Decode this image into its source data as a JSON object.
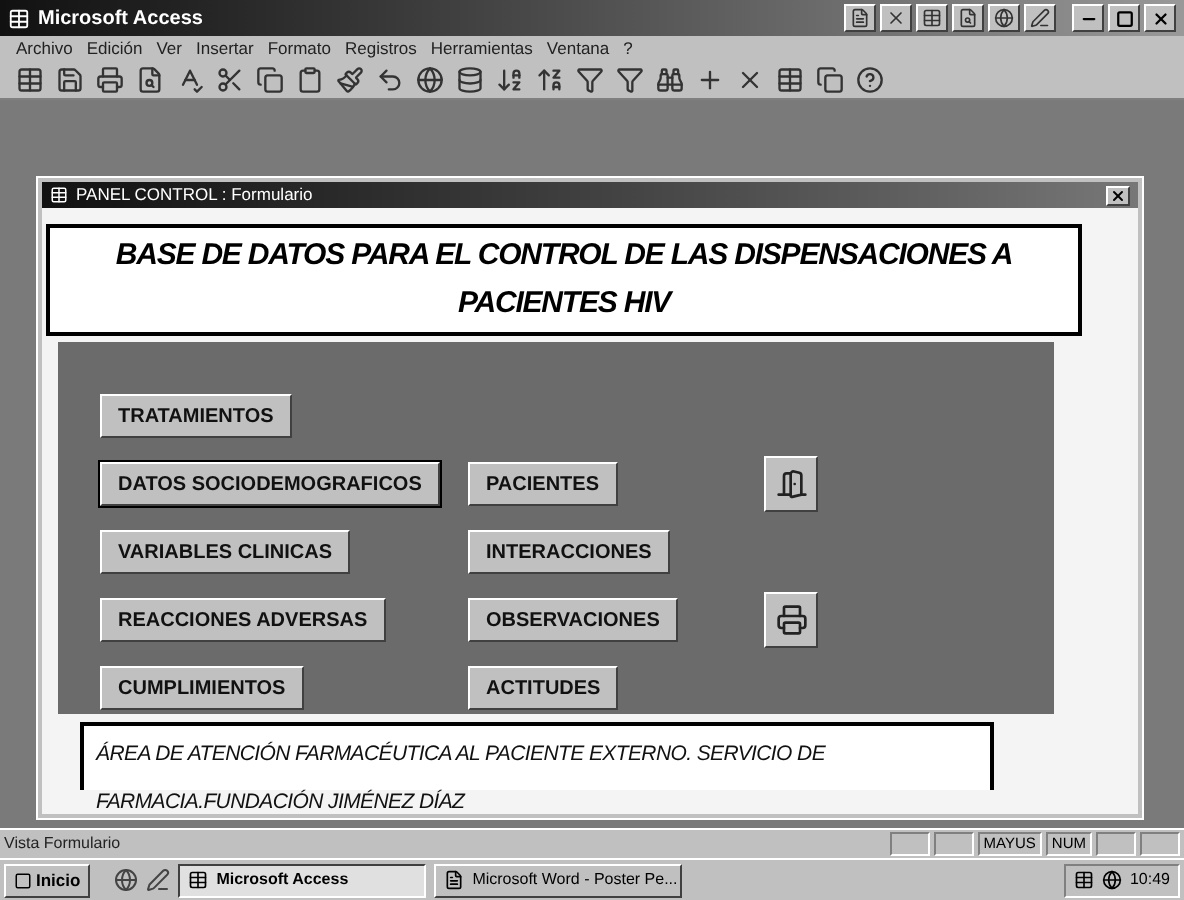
{
  "app_window": {
    "title": "Microsoft Access"
  },
  "menu": [
    "Archivo",
    "Edición",
    "Ver",
    "Insertar",
    "Formato",
    "Registros",
    "Herramientas",
    "Ventana",
    "?"
  ],
  "form_window": {
    "title": "PANEL CONTROL : Formulario"
  },
  "header": "BASE DE DATOS PARA EL CONTROL DE LAS DISPENSACIONES A PACIENTES HIV",
  "button_rows": [
    [
      {
        "kind": "text",
        "label": "TRATAMIENTOS",
        "focused": false
      }
    ],
    [
      {
        "kind": "text",
        "label": "DATOS SOCIODEMOGRAFICOS",
        "focused": true
      },
      {
        "kind": "text",
        "label": "PACIENTES",
        "focused": false
      },
      {
        "kind": "exit"
      }
    ],
    [
      {
        "kind": "text",
        "label": "VARIABLES CLINICAS",
        "focused": false
      },
      {
        "kind": "text",
        "label": "INTERACCIONES",
        "focused": false
      }
    ],
    [
      {
        "kind": "text",
        "label": "REACCIONES ADVERSAS",
        "focused": false
      },
      {
        "kind": "text",
        "label": "OBSERVACIONES",
        "focused": false
      },
      {
        "kind": "print"
      }
    ],
    [
      {
        "kind": "text",
        "label": "CUMPLIMIENTOS",
        "focused": false
      },
      {
        "kind": "text",
        "label": "ACTITUDES",
        "focused": false
      }
    ]
  ],
  "footer": "ÁREA DE ATENCIÓN FARMACÉUTICA AL PACIENTE EXTERNO. SERVICIO DE FARMACIA.FUNDACIÓN JIMÉNEZ DÍAZ",
  "status_bar": {
    "text": "Vista Formulario",
    "indicators": [
      "MAYUS",
      "NUM"
    ]
  },
  "taskbar": {
    "start": "Inicio",
    "tasks": [
      {
        "label": "Microsoft Access",
        "selected": true
      },
      {
        "label": "Microsoft Word - Poster Pe...",
        "selected": false
      }
    ],
    "clock": "10:49"
  }
}
